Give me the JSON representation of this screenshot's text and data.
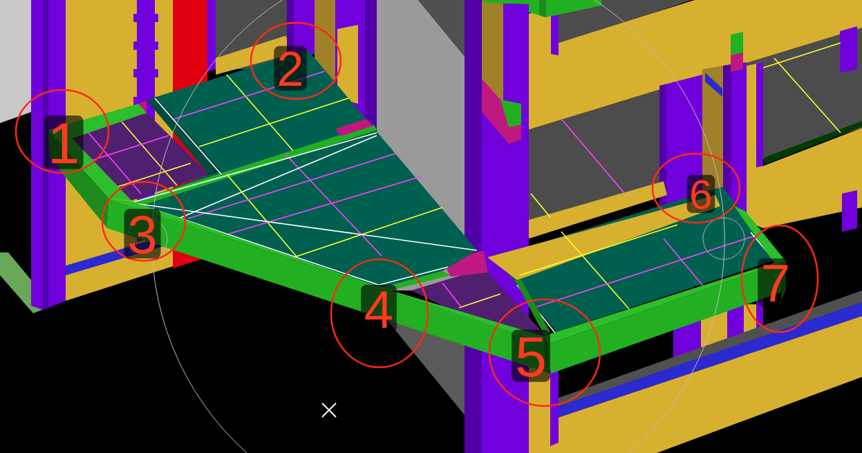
{
  "callouts": [
    {
      "label": "1"
    },
    {
      "label": "2"
    },
    {
      "label": "3"
    },
    {
      "label": "4"
    },
    {
      "label": "5"
    },
    {
      "label": "6"
    },
    {
      "label": "7"
    }
  ]
}
